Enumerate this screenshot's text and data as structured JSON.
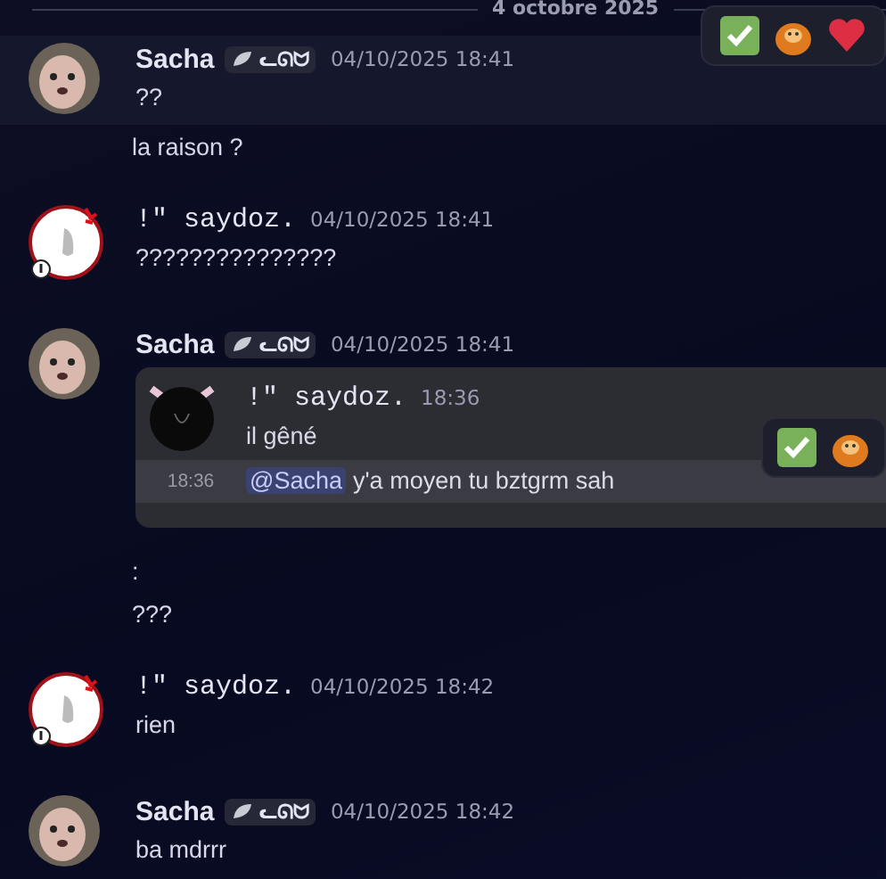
{
  "date_divider": "4 octobre 2025",
  "messages": [
    {
      "kind": "dog",
      "author": "Sacha",
      "tag": "ᓚᘏᗢ",
      "timestamp": "04/10/2025 18:41",
      "hovered": true,
      "toolbar": [
        {
          "kind": "check"
        },
        {
          "kind": "monkey"
        },
        {
          "kind": "heart"
        }
      ],
      "lines": [
        {
          "text": "??"
        },
        {
          "text": "la raison ?"
        }
      ]
    },
    {
      "kind": "ghost",
      "author": "!\" saydoz.",
      "timestamp": "04/10/2025 18:41",
      "hovered": false,
      "lines": [
        {
          "text": "???????????????"
        }
      ]
    },
    {
      "kind": "dog",
      "author": "Sacha",
      "tag": "ᓚᘏᗢ",
      "timestamp": "04/10/2025 18:41",
      "hovered": false,
      "forward": {
        "kind": "cat",
        "author": "!\" saydoz.",
        "timestamp": "18:36",
        "lines": [
          {
            "text": "il gêné",
            "hovered": false
          },
          {
            "time": "18:36",
            "mention": "@Sacha",
            "text": "y'a moyen tu bztgrm sah",
            "hovered": true,
            "toolbar": [
              {
                "kind": "check"
              },
              {
                "kind": "monkey"
              }
            ]
          }
        ]
      },
      "lines": [
        {
          "text": ":"
        },
        {
          "text": "???"
        }
      ]
    },
    {
      "kind": "ghost",
      "author": "!\" saydoz.",
      "timestamp": "04/10/2025 18:42",
      "hovered": false,
      "lines": [
        {
          "text": "rien"
        }
      ]
    },
    {
      "kind": "dog",
      "author": "Sacha",
      "tag": "ᓚᘏᗢ",
      "timestamp": "04/10/2025 18:42",
      "hovered": false,
      "lines": [
        {
          "text": "ba mdrrr"
        }
      ]
    }
  ]
}
